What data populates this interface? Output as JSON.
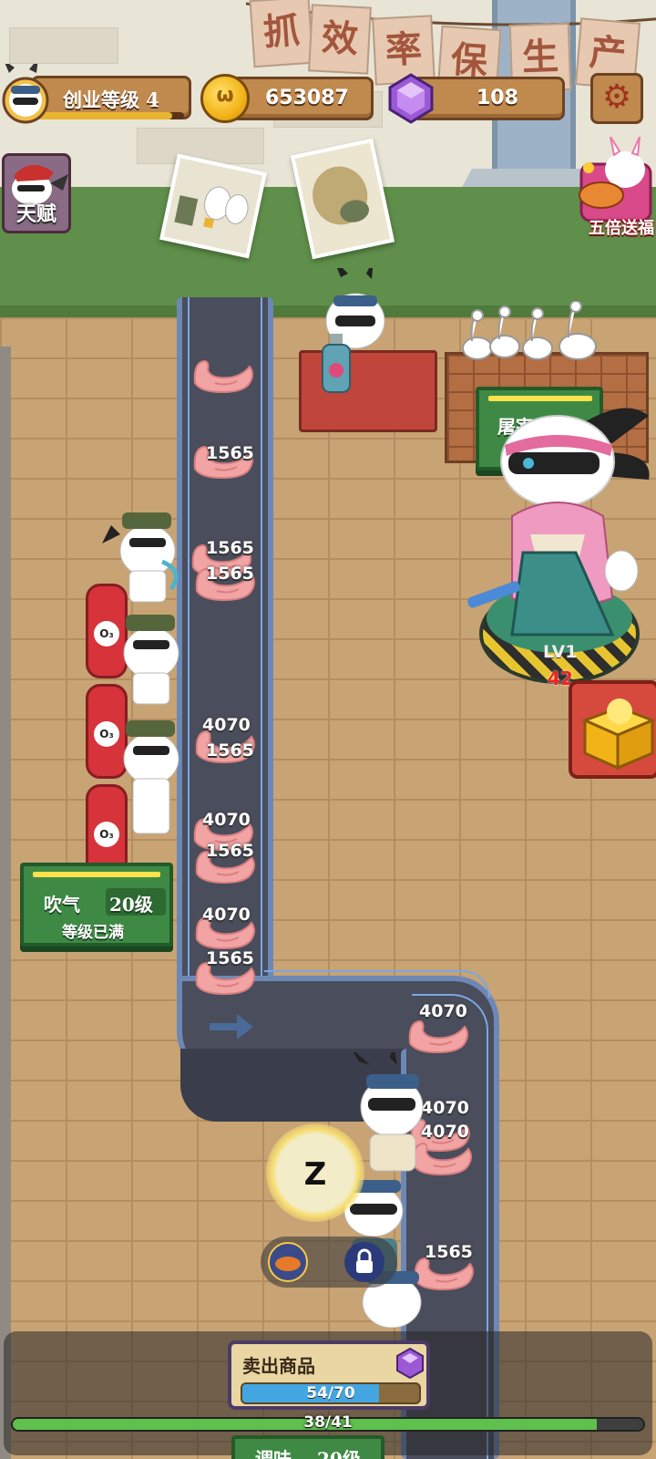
{
  "banner": {
    "chars": [
      "抓",
      "效",
      "率",
      "保",
      "生",
      "产"
    ]
  },
  "hud": {
    "level_label": "创业等级 4",
    "level_progress": 0.92,
    "coins": "653087",
    "gems": "108",
    "settings_icon": "gear-icon"
  },
  "side": {
    "talent_label": "天赋",
    "gift_label": "五倍送福"
  },
  "conveyor": {
    "left_numbers": [
      "1565",
      "1565",
      "1565",
      "4070",
      "1565",
      "4070",
      "1565",
      "4070",
      "1565"
    ],
    "right_numbers": [
      "4070",
      "4070",
      "4070",
      "1565"
    ]
  },
  "stations": {
    "inflate": {
      "name": "吹气",
      "level": "20级",
      "status": "等级已满"
    },
    "pen_sign": "屠宰",
    "dispatch": {
      "name": "调味",
      "level": "20级"
    }
  },
  "boss": {
    "level": "LV1",
    "damage": "42"
  },
  "skill": {
    "glyph": "Z"
  },
  "sell": {
    "title": "卖出商品",
    "progress_text": "54/70",
    "progress": 0.771
  },
  "overall": {
    "progress_text": "38/41",
    "progress": 0.927
  },
  "colors": {
    "coin": "#f2b319",
    "gem": "#9b59d6",
    "station_green": "#3e8a45",
    "accent_red": "#d6333a"
  }
}
